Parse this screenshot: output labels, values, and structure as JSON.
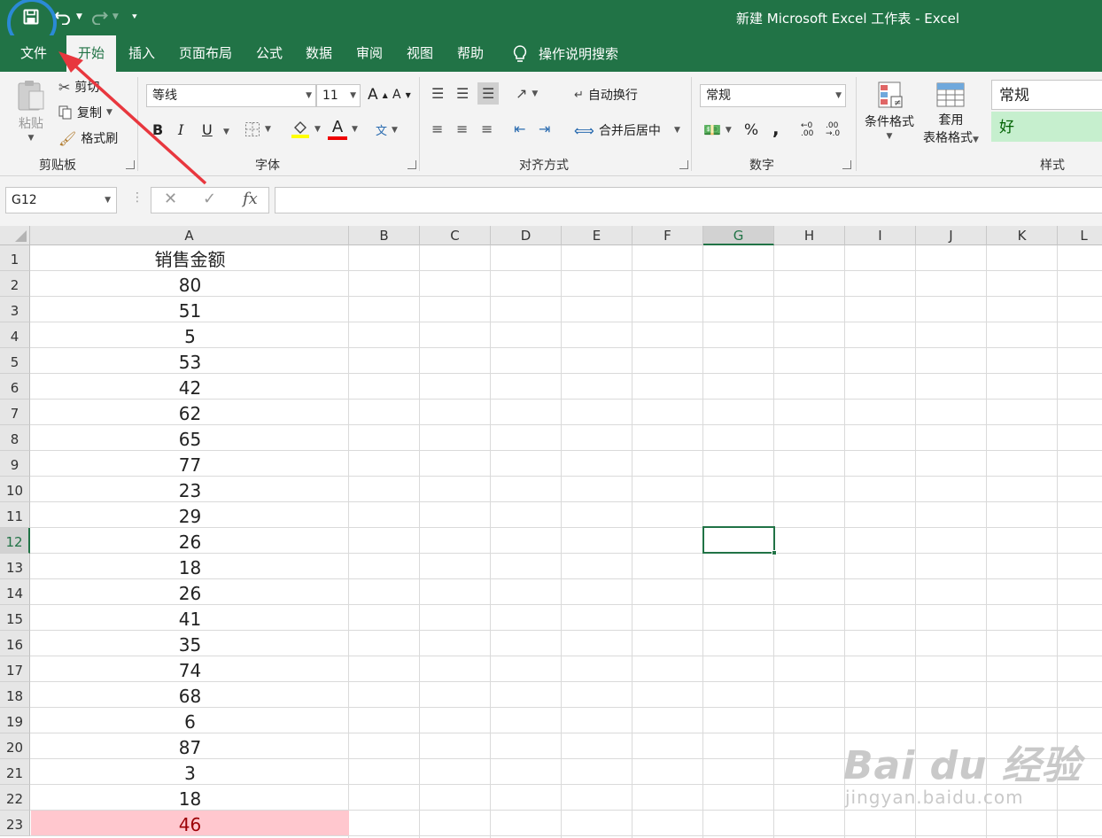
{
  "window": {
    "title": "新建 Microsoft Excel 工作表  -  Excel"
  },
  "colors": {
    "accent": "#217346",
    "highlight_fill": "#ffc7ce",
    "highlight_text": "#9c0006",
    "annotation_arrow": "#e8373e",
    "annotation_circle": "#2b8ad6",
    "style_good_fill": "#c6efce"
  },
  "tabs": [
    "文件",
    "开始",
    "插入",
    "页面布局",
    "公式",
    "数据",
    "审阅",
    "视图",
    "帮助"
  ],
  "active_tab": "开始",
  "tell_me": "操作说明搜索",
  "ribbon": {
    "clipboard": {
      "paste": "粘贴",
      "cut": "剪切",
      "copy": "复制",
      "format_painter": "格式刷",
      "label": "剪贴板"
    },
    "font": {
      "font_name": "等线",
      "font_size": "11",
      "bold": "B",
      "italic": "I",
      "underline": "U",
      "label": "字体"
    },
    "alignment": {
      "wrap_text": "自动换行",
      "merge_center": "合并后居中",
      "label": "对齐方式"
    },
    "number": {
      "format": "常规",
      "percent": "%",
      "comma": ",",
      "label": "数字"
    },
    "styles": {
      "conditional_formatting": "条件格式",
      "table_format_1": "套用",
      "table_format_2": "表格格式",
      "style_normal": "常规",
      "style_good": "好",
      "label": "样式"
    }
  },
  "formula_bar": {
    "name_box": "G12",
    "cancel": "✕",
    "enter": "✓",
    "fx": "fx",
    "formula": ""
  },
  "columns": [
    "A",
    "B",
    "C",
    "D",
    "E",
    "F",
    "G",
    "H",
    "I",
    "J",
    "K",
    "L"
  ],
  "selected_column": "G",
  "selected_row": "12",
  "rows": [
    {
      "num": "1",
      "a": "销售金额"
    },
    {
      "num": "2",
      "a": "80"
    },
    {
      "num": "3",
      "a": "51"
    },
    {
      "num": "4",
      "a": "5"
    },
    {
      "num": "5",
      "a": "53"
    },
    {
      "num": "6",
      "a": "42"
    },
    {
      "num": "7",
      "a": "62"
    },
    {
      "num": "8",
      "a": "65"
    },
    {
      "num": "9",
      "a": "77"
    },
    {
      "num": "10",
      "a": "23"
    },
    {
      "num": "11",
      "a": "29"
    },
    {
      "num": "12",
      "a": "26"
    },
    {
      "num": "13",
      "a": "18"
    },
    {
      "num": "14",
      "a": "26"
    },
    {
      "num": "15",
      "a": "41"
    },
    {
      "num": "16",
      "a": "35"
    },
    {
      "num": "17",
      "a": "74"
    },
    {
      "num": "18",
      "a": "68"
    },
    {
      "num": "19",
      "a": "6"
    },
    {
      "num": "20",
      "a": "87"
    },
    {
      "num": "21",
      "a": "3"
    },
    {
      "num": "22",
      "a": "18"
    },
    {
      "num": "23",
      "a": "46",
      "highlight": true
    }
  ],
  "watermark": {
    "main": "Bai du 经验",
    "sub": "jingyan.baidu.com"
  }
}
